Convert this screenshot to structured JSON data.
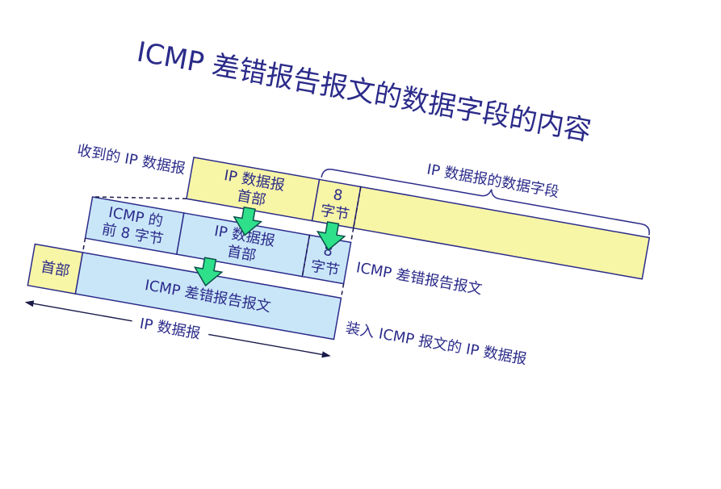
{
  "title": "ICMP 差错报告报文的数据字段的内容",
  "labels": {
    "received_ip_datagram": "收到的 IP 数据报",
    "ip_header_line1": "IP 数据报",
    "ip_header_line2": "首部",
    "eight_bytes_num": "8",
    "eight_bytes_unit": "字节",
    "ip_data_field": "IP 数据报的数据字段",
    "icmp_first8_line1": "ICMP 的",
    "icmp_first8_line2": "前 8 字节",
    "header": "首部",
    "icmp_error_message_inner": "ICMP 差错报告报文",
    "icmp_error_message_side": "ICMP 差错报告报文",
    "ip_datagram_span": "IP 数据报",
    "encapsulated": "装入 ICMP 报文的 IP 数据报"
  },
  "colors": {
    "text": "#2b2b8a",
    "yellow_fill": "#f7f5a6",
    "blue_fill": "#c9e6f8",
    "arrow_fill": "#2ee08a"
  }
}
